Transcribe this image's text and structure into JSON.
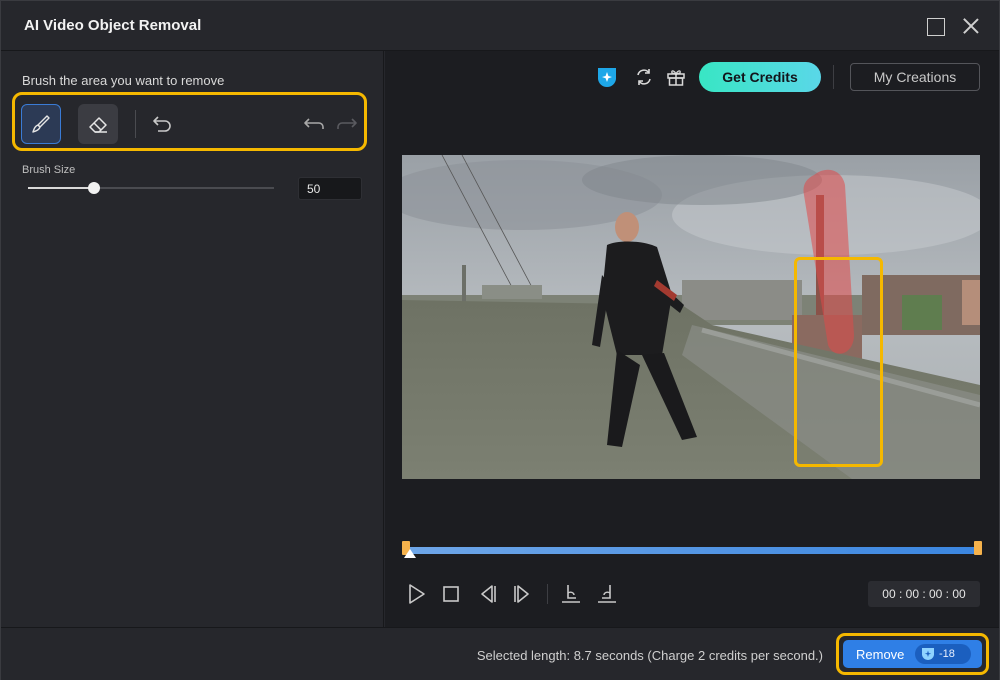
{
  "window": {
    "title": "AI Video Object Removal"
  },
  "left": {
    "brush_title": "Brush the area you want to remove",
    "tools": [
      "brush",
      "eraser"
    ],
    "active_tool": "brush",
    "brush_size_label": "Brush Size",
    "brush_size_value": "50",
    "brush_size_fraction": 0.27
  },
  "header": {
    "get_credits_label": "Get Credits",
    "my_creations_label": "My Creations"
  },
  "player": {
    "timecode": "00 : 00 : 00 : 00",
    "controls": [
      "play-icon",
      "stop-icon",
      "previous-frame-icon",
      "next-frame-icon",
      "mark-in-icon",
      "mark-out-icon"
    ]
  },
  "footer": {
    "selected_length_text": "Selected length: 8.7 seconds (Charge 2 credits per second.)",
    "remove_label": "Remove",
    "remove_cost": "-18"
  },
  "colors": {
    "accent_blue": "#2f7fe6",
    "highlight_yellow": "#f5b800",
    "credits_gradient_start": "#38e6c4",
    "credits_gradient_end": "#5ad7e8",
    "mask_red": "#e04848"
  }
}
